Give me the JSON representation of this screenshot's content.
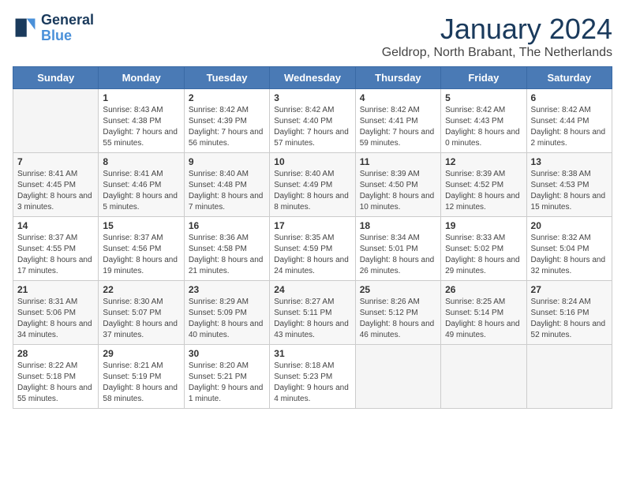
{
  "logo": {
    "line1": "General",
    "line2": "Blue"
  },
  "title": "January 2024",
  "location": "Geldrop, North Brabant, The Netherlands",
  "weekdays": [
    "Sunday",
    "Monday",
    "Tuesday",
    "Wednesday",
    "Thursday",
    "Friday",
    "Saturday"
  ],
  "weeks": [
    [
      {
        "day": "",
        "sunrise": "",
        "sunset": "",
        "daylight": "",
        "empty": true
      },
      {
        "day": "1",
        "sunrise": "Sunrise: 8:43 AM",
        "sunset": "Sunset: 4:38 PM",
        "daylight": "Daylight: 7 hours and 55 minutes."
      },
      {
        "day": "2",
        "sunrise": "Sunrise: 8:42 AM",
        "sunset": "Sunset: 4:39 PM",
        "daylight": "Daylight: 7 hours and 56 minutes."
      },
      {
        "day": "3",
        "sunrise": "Sunrise: 8:42 AM",
        "sunset": "Sunset: 4:40 PM",
        "daylight": "Daylight: 7 hours and 57 minutes."
      },
      {
        "day": "4",
        "sunrise": "Sunrise: 8:42 AM",
        "sunset": "Sunset: 4:41 PM",
        "daylight": "Daylight: 7 hours and 59 minutes."
      },
      {
        "day": "5",
        "sunrise": "Sunrise: 8:42 AM",
        "sunset": "Sunset: 4:43 PM",
        "daylight": "Daylight: 8 hours and 0 minutes."
      },
      {
        "day": "6",
        "sunrise": "Sunrise: 8:42 AM",
        "sunset": "Sunset: 4:44 PM",
        "daylight": "Daylight: 8 hours and 2 minutes."
      }
    ],
    [
      {
        "day": "7",
        "sunrise": "Sunrise: 8:41 AM",
        "sunset": "Sunset: 4:45 PM",
        "daylight": "Daylight: 8 hours and 3 minutes."
      },
      {
        "day": "8",
        "sunrise": "Sunrise: 8:41 AM",
        "sunset": "Sunset: 4:46 PM",
        "daylight": "Daylight: 8 hours and 5 minutes."
      },
      {
        "day": "9",
        "sunrise": "Sunrise: 8:40 AM",
        "sunset": "Sunset: 4:48 PM",
        "daylight": "Daylight: 8 hours and 7 minutes."
      },
      {
        "day": "10",
        "sunrise": "Sunrise: 8:40 AM",
        "sunset": "Sunset: 4:49 PM",
        "daylight": "Daylight: 8 hours and 8 minutes."
      },
      {
        "day": "11",
        "sunrise": "Sunrise: 8:39 AM",
        "sunset": "Sunset: 4:50 PM",
        "daylight": "Daylight: 8 hours and 10 minutes."
      },
      {
        "day": "12",
        "sunrise": "Sunrise: 8:39 AM",
        "sunset": "Sunset: 4:52 PM",
        "daylight": "Daylight: 8 hours and 12 minutes."
      },
      {
        "day": "13",
        "sunrise": "Sunrise: 8:38 AM",
        "sunset": "Sunset: 4:53 PM",
        "daylight": "Daylight: 8 hours and 15 minutes."
      }
    ],
    [
      {
        "day": "14",
        "sunrise": "Sunrise: 8:37 AM",
        "sunset": "Sunset: 4:55 PM",
        "daylight": "Daylight: 8 hours and 17 minutes."
      },
      {
        "day": "15",
        "sunrise": "Sunrise: 8:37 AM",
        "sunset": "Sunset: 4:56 PM",
        "daylight": "Daylight: 8 hours and 19 minutes."
      },
      {
        "day": "16",
        "sunrise": "Sunrise: 8:36 AM",
        "sunset": "Sunset: 4:58 PM",
        "daylight": "Daylight: 8 hours and 21 minutes."
      },
      {
        "day": "17",
        "sunrise": "Sunrise: 8:35 AM",
        "sunset": "Sunset: 4:59 PM",
        "daylight": "Daylight: 8 hours and 24 minutes."
      },
      {
        "day": "18",
        "sunrise": "Sunrise: 8:34 AM",
        "sunset": "Sunset: 5:01 PM",
        "daylight": "Daylight: 8 hours and 26 minutes."
      },
      {
        "day": "19",
        "sunrise": "Sunrise: 8:33 AM",
        "sunset": "Sunset: 5:02 PM",
        "daylight": "Daylight: 8 hours and 29 minutes."
      },
      {
        "day": "20",
        "sunrise": "Sunrise: 8:32 AM",
        "sunset": "Sunset: 5:04 PM",
        "daylight": "Daylight: 8 hours and 32 minutes."
      }
    ],
    [
      {
        "day": "21",
        "sunrise": "Sunrise: 8:31 AM",
        "sunset": "Sunset: 5:06 PM",
        "daylight": "Daylight: 8 hours and 34 minutes."
      },
      {
        "day": "22",
        "sunrise": "Sunrise: 8:30 AM",
        "sunset": "Sunset: 5:07 PM",
        "daylight": "Daylight: 8 hours and 37 minutes."
      },
      {
        "day": "23",
        "sunrise": "Sunrise: 8:29 AM",
        "sunset": "Sunset: 5:09 PM",
        "daylight": "Daylight: 8 hours and 40 minutes."
      },
      {
        "day": "24",
        "sunrise": "Sunrise: 8:27 AM",
        "sunset": "Sunset: 5:11 PM",
        "daylight": "Daylight: 8 hours and 43 minutes."
      },
      {
        "day": "25",
        "sunrise": "Sunrise: 8:26 AM",
        "sunset": "Sunset: 5:12 PM",
        "daylight": "Daylight: 8 hours and 46 minutes."
      },
      {
        "day": "26",
        "sunrise": "Sunrise: 8:25 AM",
        "sunset": "Sunset: 5:14 PM",
        "daylight": "Daylight: 8 hours and 49 minutes."
      },
      {
        "day": "27",
        "sunrise": "Sunrise: 8:24 AM",
        "sunset": "Sunset: 5:16 PM",
        "daylight": "Daylight: 8 hours and 52 minutes."
      }
    ],
    [
      {
        "day": "28",
        "sunrise": "Sunrise: 8:22 AM",
        "sunset": "Sunset: 5:18 PM",
        "daylight": "Daylight: 8 hours and 55 minutes."
      },
      {
        "day": "29",
        "sunrise": "Sunrise: 8:21 AM",
        "sunset": "Sunset: 5:19 PM",
        "daylight": "Daylight: 8 hours and 58 minutes."
      },
      {
        "day": "30",
        "sunrise": "Sunrise: 8:20 AM",
        "sunset": "Sunset: 5:21 PM",
        "daylight": "Daylight: 9 hours and 1 minute."
      },
      {
        "day": "31",
        "sunrise": "Sunrise: 8:18 AM",
        "sunset": "Sunset: 5:23 PM",
        "daylight": "Daylight: 9 hours and 4 minutes."
      },
      {
        "day": "",
        "sunrise": "",
        "sunset": "",
        "daylight": "",
        "empty": true
      },
      {
        "day": "",
        "sunrise": "",
        "sunset": "",
        "daylight": "",
        "empty": true
      },
      {
        "day": "",
        "sunrise": "",
        "sunset": "",
        "daylight": "",
        "empty": true
      }
    ]
  ]
}
